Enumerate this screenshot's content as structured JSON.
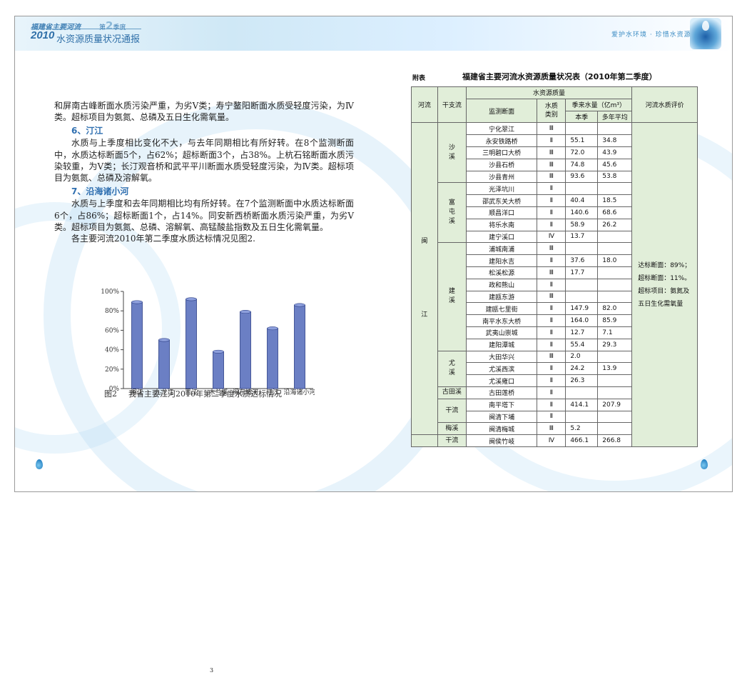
{
  "header": {
    "subtitle": "福建省主要河流",
    "season_prefix": "第",
    "season_num": "2",
    "season_suffix": "季度",
    "year": "2010",
    "title": "水资源质量状况通报",
    "slogan": "爱护水环境 · 珍惜水资源"
  },
  "text": {
    "para1": "和屏南古峰断面水质污染严重，为劣Ⅴ类；寿宁鳌阳断面水质受轻度污染，为Ⅳ类。超标项目为氨氮、总磷及五日生化需氧量。",
    "section6": "6、汀江",
    "para2": "水质与上季度相比变化不大，与去年同期相比有所好转。在8个监测断面中，水质达标断面5个，占62%；超标断面3个，占38%。上杭石铭断面水质污染较重，为Ⅴ类；长汀观音桥和武平平川断面水质受轻度污染，为Ⅳ类。超标项目为氨氮、总磷及溶解氧。",
    "section7": "7、沿海诸小河",
    "para3": "水质与上季度和去年同期相比均有所好转。在7个监测断面中水质达标断面6个，占86%；超标断面1个，占14%。同安新西桥断面水质污染严重，为劣Ⅴ类。超标项目为氨氮、总磷、溶解氧、高锰酸盐指数及五日生化需氧量。",
    "para4": "各主要河流2010年第二季度水质达标情况见图2."
  },
  "chart_data": {
    "type": "bar",
    "categories": [
      "闽江",
      "九龙江",
      "晋江",
      "木兰溪",
      "闽东诸河",
      "汀江",
      "沿海诸小河"
    ],
    "values": [
      89,
      50,
      92,
      38,
      79,
      62,
      86
    ],
    "ylim": [
      0,
      100
    ],
    "yticks": [
      "0%",
      "20%",
      "40%",
      "60%",
      "80%",
      "100%"
    ],
    "bar_color": "#6b7fc4",
    "title": "",
    "xlabel": "",
    "ylabel": ""
  },
  "figure": {
    "caption_num": "图2",
    "caption_text": "我省主要江河2010年第二季度水质达标情况"
  },
  "table": {
    "label": "附表",
    "title": "福建省主要河流水资源质量状况表（2010年第二季度）",
    "headers": {
      "river": "河流",
      "branch": "干支流",
      "resource_quality": "水资源质量",
      "station": "监测断面",
      "class_line1": "水质",
      "class_line2": "类别",
      "volume": "季来水量（亿m³）",
      "current": "本季",
      "average": "多年平均",
      "evaluation": "河流水质评价"
    },
    "river_name_1": "闽",
    "river_name_2": "江",
    "branches": {
      "shaxi": [
        "沙",
        "溪"
      ],
      "futunxi": [
        "富",
        "屯",
        "溪"
      ],
      "jianxi": [
        "建",
        "溪"
      ],
      "youxi": [
        "尤",
        "溪"
      ],
      "gutianxi": "古田溪",
      "ganliu1": "干流",
      "meixi": "梅溪",
      "ganliu2": "干流"
    },
    "rows": [
      {
        "station": "宁化翠江",
        "class": "Ⅲ",
        "current": "",
        "average": ""
      },
      {
        "station": "永安铁路桥",
        "class": "Ⅱ",
        "current": "55.1",
        "average": "34.8"
      },
      {
        "station": "三明碧口大桥",
        "class": "Ⅲ",
        "current": "72.0",
        "average": "43.9"
      },
      {
        "station": "沙县石桥",
        "class": "Ⅲ",
        "current": "74.8",
        "average": "45.6"
      },
      {
        "station": "沙县青州",
        "class": "Ⅲ",
        "current": "93.6",
        "average": "53.8"
      },
      {
        "station": "光泽坑川",
        "class": "Ⅱ",
        "current": "",
        "average": ""
      },
      {
        "station": "邵武东关大桥",
        "class": "Ⅱ",
        "current": "40.4",
        "average": "18.5"
      },
      {
        "station": "顺昌洋口",
        "class": "Ⅱ",
        "current": "140.6",
        "average": "68.6"
      },
      {
        "station": "将乐水南",
        "class": "Ⅱ",
        "current": "58.9",
        "average": "26.2"
      },
      {
        "station": "建宁溪口",
        "class": "Ⅳ",
        "current": "13.7",
        "average": ""
      },
      {
        "station": "浦城南浦",
        "class": "Ⅲ",
        "current": "",
        "average": ""
      },
      {
        "station": "建阳水吉",
        "class": "Ⅱ",
        "current": "37.6",
        "average": "18.0"
      },
      {
        "station": "松溪松源",
        "class": "Ⅲ",
        "current": "17.7",
        "average": ""
      },
      {
        "station": "政和熊山",
        "class": "Ⅱ",
        "current": "",
        "average": ""
      },
      {
        "station": "建瓯东游",
        "class": "Ⅲ",
        "current": "",
        "average": ""
      },
      {
        "station": "建瓯七里街",
        "class": "Ⅱ",
        "current": "147.9",
        "average": "82.0"
      },
      {
        "station": "南平水东大桥",
        "class": "Ⅱ",
        "current": "164.0",
        "average": "85.9"
      },
      {
        "station": "武夷山崇城",
        "class": "Ⅱ",
        "current": "12.7",
        "average": "7.1"
      },
      {
        "station": "建阳潭城",
        "class": "Ⅱ",
        "current": "55.4",
        "average": "29.3"
      },
      {
        "station": "大田华兴",
        "class": "Ⅲ",
        "current": "2.0",
        "average": ""
      },
      {
        "station": "尤溪西滨",
        "class": "Ⅱ",
        "current": "24.2",
        "average": "13.9"
      },
      {
        "station": "尤溪雍口",
        "class": "Ⅱ",
        "current": "26.3",
        "average": ""
      },
      {
        "station": "古田莲桥",
        "class": "Ⅱ",
        "current": "",
        "average": ""
      },
      {
        "station": "南平塔下",
        "class": "Ⅱ",
        "current": "414.1",
        "average": "207.9"
      },
      {
        "station": "闽清下埔",
        "class": "Ⅱ",
        "current": "",
        "average": ""
      },
      {
        "station": "闽清梅城",
        "class": "Ⅲ",
        "current": "5.2",
        "average": ""
      },
      {
        "station": "闽侯竹岐",
        "class": "Ⅳ",
        "current": "466.1",
        "average": "266.8"
      }
    ],
    "evaluation": {
      "line1": "达标断面：89%；",
      "line2": "超标断面：11%。",
      "line3": "超标项目：氨氮及",
      "line4": "五日生化需氧量"
    }
  },
  "page_number": "3"
}
